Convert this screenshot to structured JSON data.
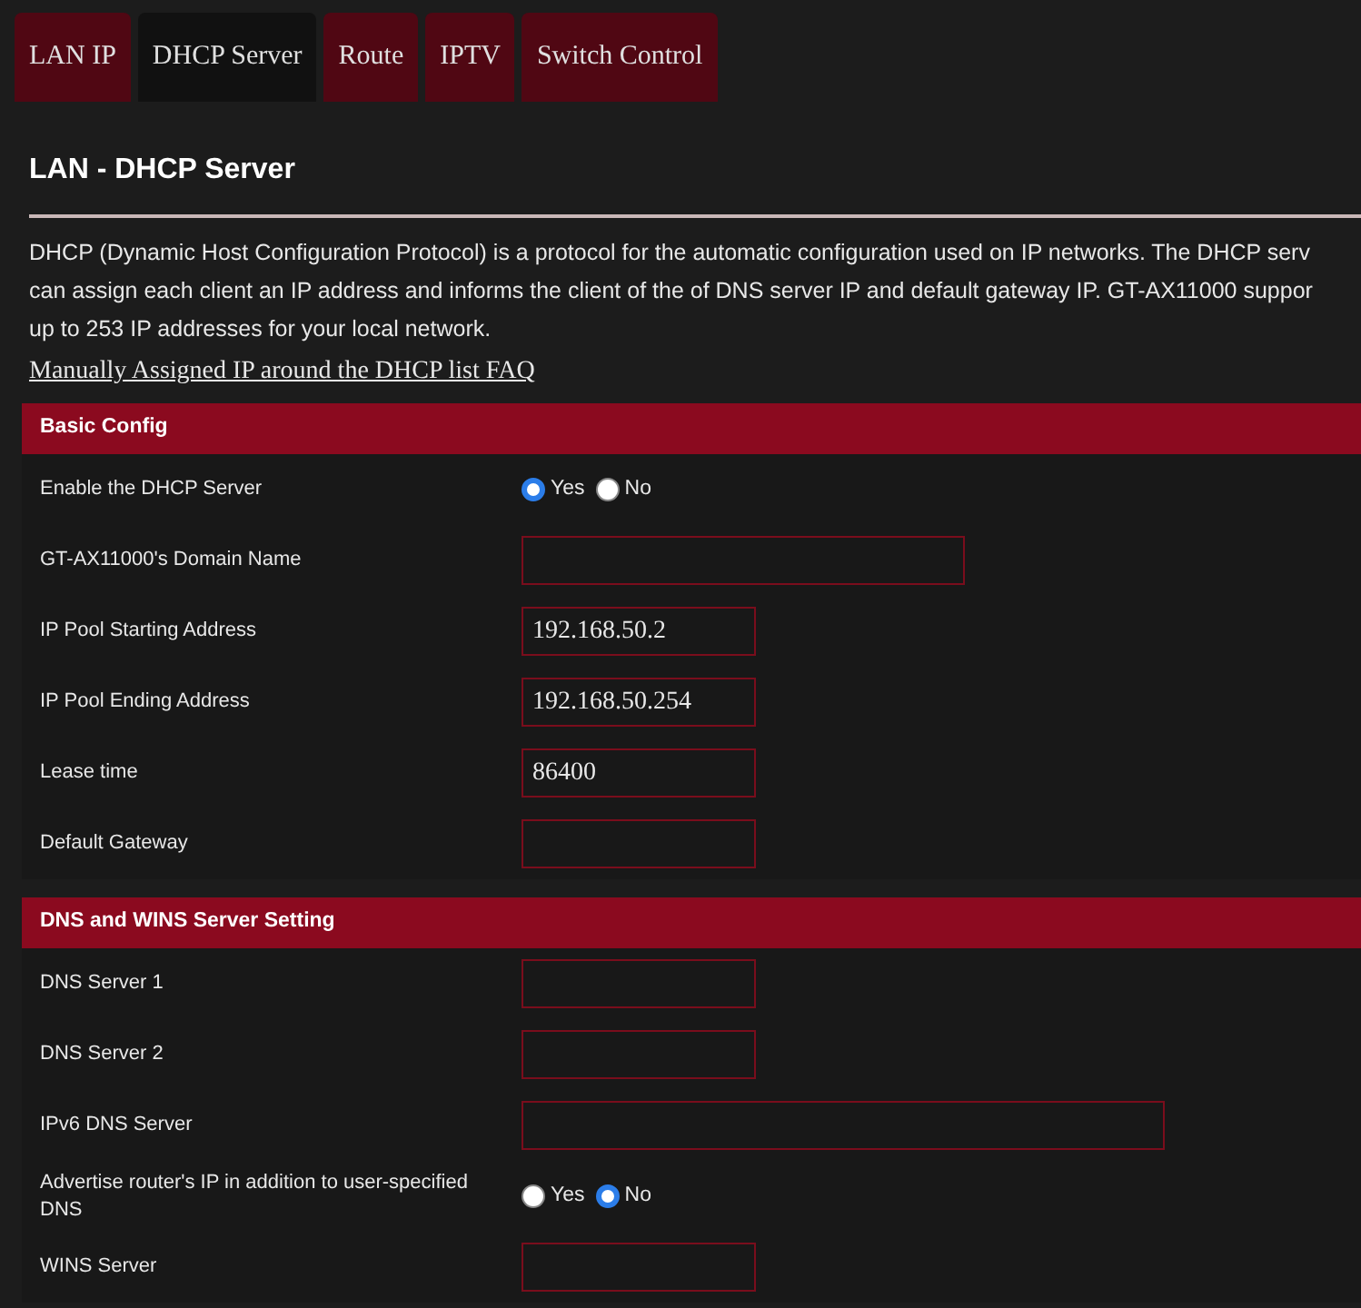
{
  "tabs": [
    {
      "label": "LAN IP",
      "selected": false
    },
    {
      "label": "DHCP Server",
      "selected": true
    },
    {
      "label": "Route",
      "selected": false
    },
    {
      "label": "IPTV",
      "selected": false
    },
    {
      "label": "Switch Control",
      "selected": false
    }
  ],
  "page_title": "LAN - DHCP Server",
  "description_lines": [
    "DHCP (Dynamic Host Configuration Protocol) is a protocol for the automatic configuration used on IP networks. The DHCP serv",
    "can assign each client an IP address and informs the client of the of DNS server IP and default gateway IP. GT-AX11000 suppor",
    "up to 253 IP addresses for your local network."
  ],
  "faq_link": "Manually Assigned IP around the DHCP list FAQ",
  "sections": [
    {
      "title": "Basic Config",
      "rows": [
        {
          "kind": "radio",
          "label": "Enable the DHCP Server",
          "options": [
            {
              "label": "Yes",
              "selected": true
            },
            {
              "label": "No",
              "selected": false
            }
          ]
        },
        {
          "kind": "wide",
          "label": "GT-AX11000's Domain Name"
        },
        {
          "kind": "text",
          "label": "IP Pool Starting Address",
          "value": "192.168.50.2"
        },
        {
          "kind": "text",
          "label": "IP Pool Ending Address",
          "value": "192.168.50.254"
        },
        {
          "kind": "text",
          "label": "Lease time",
          "value": "86400"
        },
        {
          "kind": "text",
          "label": "Default Gateway"
        }
      ]
    },
    {
      "title": "DNS and WINS Server Setting",
      "rows": [
        {
          "kind": "text",
          "label": "DNS Server 1"
        },
        {
          "kind": "text",
          "label": "DNS Server 2"
        },
        {
          "kind": "long",
          "label": "IPv6 DNS Server"
        },
        {
          "kind": "radio",
          "label": "Advertise router's IP in addition to user-specified DNS",
          "options": [
            {
              "label": "Yes",
              "selected": false
            },
            {
              "label": "No",
              "selected": true
            }
          ]
        },
        {
          "kind": "text",
          "label": "WINS Server"
        }
      ]
    }
  ]
}
